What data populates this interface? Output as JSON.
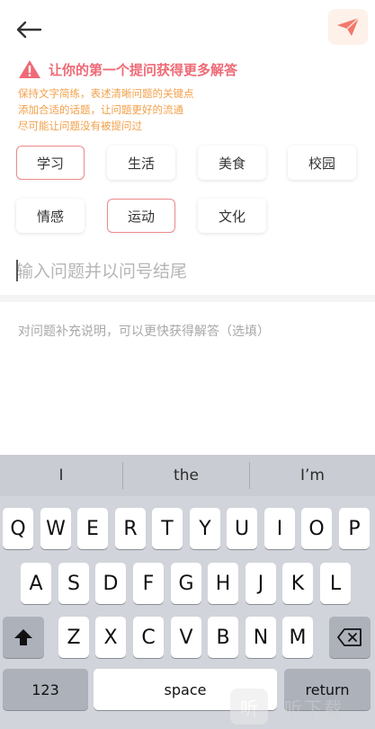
{
  "tips": {
    "title": "让你的第一个提问获得更多解答",
    "lines": [
      "保持文字简练，表述清晰问题的关键点",
      "添加合适的话题，让问题更好的流通",
      "尽可能让问题没有被提问过"
    ]
  },
  "tags": [
    {
      "label": "学习",
      "selected": true
    },
    {
      "label": "生活",
      "selected": false
    },
    {
      "label": "美食",
      "selected": false
    },
    {
      "label": "校园",
      "selected": false
    },
    {
      "label": "情感",
      "selected": false
    },
    {
      "label": "运动",
      "selected": true
    },
    {
      "label": "文化",
      "selected": false
    }
  ],
  "question": {
    "value": "",
    "placeholder": "输入问题并以问号结尾"
  },
  "description": {
    "value": "",
    "placeholder": "对问题补充说明，可以更快获得解答（选填）"
  },
  "keyboard": {
    "suggestions": [
      "I",
      "the",
      "I’m"
    ],
    "row1": [
      "Q",
      "W",
      "E",
      "R",
      "T",
      "Y",
      "U",
      "I",
      "O",
      "P"
    ],
    "row2": [
      "A",
      "S",
      "D",
      "F",
      "G",
      "H",
      "J",
      "K",
      "L"
    ],
    "row3": [
      "Z",
      "X",
      "C",
      "V",
      "B",
      "N",
      "M"
    ],
    "numbers_label": "123",
    "space_label": "space",
    "return_label": "return"
  },
  "watermark": {
    "badge": "听",
    "text": "听下载"
  },
  "colors": {
    "accent": "#ee6a76",
    "tip_text": "#f2a04a",
    "send_icon": "#f2786a"
  }
}
